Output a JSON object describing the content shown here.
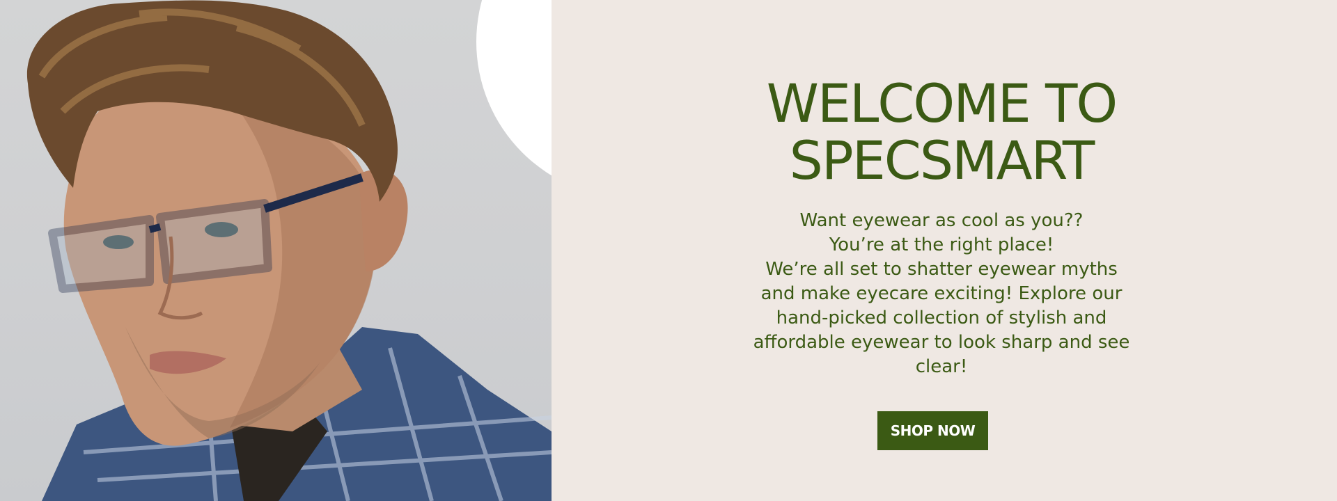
{
  "hero": {
    "image_alt": "Man with curly hair wearing dark blue rectangular eyeglasses and a plaid shirt",
    "headline_line1": "WELCOME TO",
    "headline_line2": "SPECSMART",
    "tagline_line1": "Want eyewear as cool as you??",
    "tagline_line2": "You’re at the right place!",
    "body": "We’re all set to shatter eyewear myths and make eyecare exciting! Explore our hand-picked collection of stylish and affordable eyewear to look sharp and see clear!",
    "cta_label": "SHOP NOW"
  },
  "colors": {
    "accent": "#3b5a14",
    "panel_background": "#efe8e3",
    "cta_text": "#ffffff"
  }
}
